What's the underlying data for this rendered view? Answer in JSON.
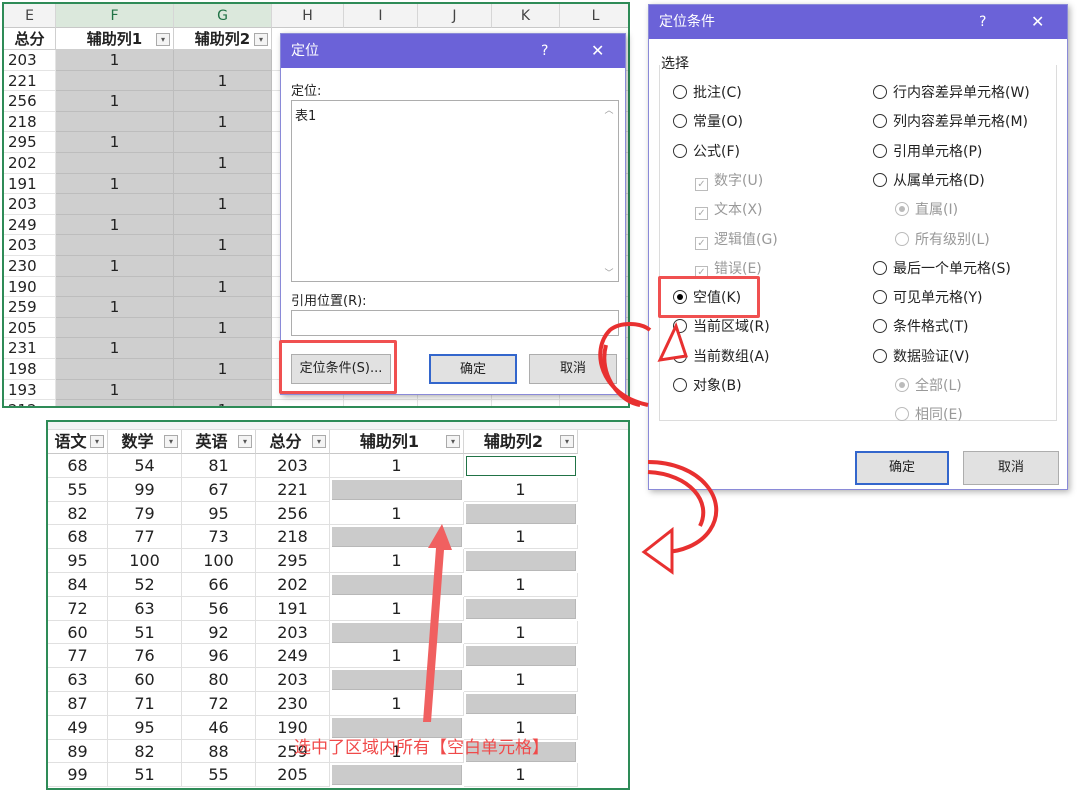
{
  "sheet1": {
    "col_letters": [
      "E",
      "F",
      "G",
      "H",
      "I",
      "J",
      "K",
      "L"
    ],
    "headers": [
      "总分",
      "辅助列1",
      "辅助列2"
    ],
    "rows": [
      [
        "203",
        "1",
        ""
      ],
      [
        "221",
        "",
        "1"
      ],
      [
        "256",
        "1",
        ""
      ],
      [
        "218",
        "",
        "1"
      ],
      [
        "295",
        "1",
        ""
      ],
      [
        "202",
        "",
        "1"
      ],
      [
        "191",
        "1",
        ""
      ],
      [
        "203",
        "",
        "1"
      ],
      [
        "249",
        "1",
        ""
      ],
      [
        "203",
        "",
        "1"
      ],
      [
        "230",
        "1",
        ""
      ],
      [
        "190",
        "",
        "1"
      ],
      [
        "259",
        "1",
        ""
      ],
      [
        "205",
        "",
        "1"
      ],
      [
        "231",
        "1",
        ""
      ],
      [
        "198",
        "",
        "1"
      ],
      [
        "193",
        "1",
        ""
      ],
      [
        "212",
        "",
        "1"
      ]
    ]
  },
  "goto_dialog": {
    "title": "定位",
    "help": "?",
    "close": "✕",
    "goto_label": "定位:",
    "list_items": [
      "表1"
    ],
    "ref_label": "引用位置(R):",
    "ref_value": "",
    "special_button": "定位条件(S)...",
    "ok_button": "确定",
    "cancel_button": "取消"
  },
  "special_dialog": {
    "title": "定位条件",
    "help": "?",
    "close": "✕",
    "group_label": "选择",
    "left_options": [
      {
        "label": "批注(C)",
        "type": "radio",
        "checked": false,
        "disabled": false
      },
      {
        "label": "常量(O)",
        "type": "radio",
        "checked": false,
        "disabled": false
      },
      {
        "label": "公式(F)",
        "type": "radio",
        "checked": false,
        "disabled": false
      },
      {
        "label": "数字(U)",
        "type": "check",
        "checked": true,
        "disabled": true
      },
      {
        "label": "文本(X)",
        "type": "check",
        "checked": true,
        "disabled": true
      },
      {
        "label": "逻辑值(G)",
        "type": "check",
        "checked": true,
        "disabled": true
      },
      {
        "label": "错误(E)",
        "type": "check",
        "checked": true,
        "disabled": true
      },
      {
        "label": "空值(K)",
        "type": "radio",
        "checked": true,
        "disabled": false
      },
      {
        "label": "当前区域(R)",
        "type": "radio",
        "checked": false,
        "disabled": false
      },
      {
        "label": "当前数组(A)",
        "type": "radio",
        "checked": false,
        "disabled": false
      },
      {
        "label": "对象(B)",
        "type": "radio",
        "checked": false,
        "disabled": false
      }
    ],
    "right_options": [
      {
        "label": "行内容差异单元格(W)",
        "type": "radio",
        "checked": false,
        "disabled": false
      },
      {
        "label": "列内容差异单元格(M)",
        "type": "radio",
        "checked": false,
        "disabled": false
      },
      {
        "label": "引用单元格(P)",
        "type": "radio",
        "checked": false,
        "disabled": false
      },
      {
        "label": "从属单元格(D)",
        "type": "radio",
        "checked": false,
        "disabled": false
      },
      {
        "label": "直属(I)",
        "type": "radio",
        "checked": true,
        "disabled": true
      },
      {
        "label": "所有级别(L)",
        "type": "radio",
        "checked": false,
        "disabled": true
      },
      {
        "label": "最后一个单元格(S)",
        "type": "radio",
        "checked": false,
        "disabled": false
      },
      {
        "label": "可见单元格(Y)",
        "type": "radio",
        "checked": false,
        "disabled": false
      },
      {
        "label": "条件格式(T)",
        "type": "radio",
        "checked": false,
        "disabled": false
      },
      {
        "label": "数据验证(V)",
        "type": "radio",
        "checked": false,
        "disabled": false
      },
      {
        "label": "全部(L)",
        "type": "radio",
        "checked": true,
        "disabled": true
      },
      {
        "label": "相同(E)",
        "type": "radio",
        "checked": false,
        "disabled": true
      }
    ],
    "ok_button": "确定",
    "cancel_button": "取消"
  },
  "sheet2": {
    "headers": [
      "语文",
      "数学",
      "英语",
      "总分",
      "辅助列1",
      "辅助列2"
    ],
    "rows": [
      [
        "68",
        "54",
        "81",
        "203",
        "1",
        ""
      ],
      [
        "55",
        "99",
        "67",
        "221",
        "",
        "1"
      ],
      [
        "82",
        "79",
        "95",
        "256",
        "1",
        ""
      ],
      [
        "68",
        "77",
        "73",
        "218",
        "",
        "1"
      ],
      [
        "95",
        "100",
        "100",
        "295",
        "1",
        ""
      ],
      [
        "84",
        "52",
        "66",
        "202",
        "",
        "1"
      ],
      [
        "72",
        "63",
        "56",
        "191",
        "1",
        ""
      ],
      [
        "60",
        "51",
        "92",
        "203",
        "",
        "1"
      ],
      [
        "77",
        "76",
        "96",
        "249",
        "1",
        ""
      ],
      [
        "63",
        "60",
        "80",
        "203",
        "",
        "1"
      ],
      [
        "87",
        "71",
        "72",
        "230",
        "1",
        ""
      ],
      [
        "49",
        "95",
        "46",
        "190",
        "",
        "1"
      ],
      [
        "89",
        "82",
        "88",
        "259",
        "1",
        ""
      ],
      [
        "99",
        "51",
        "55",
        "205",
        "",
        "1"
      ]
    ]
  },
  "annotation": "选中了区域内所有【空白单元格】",
  "colors": {
    "accent": "#6b62d8",
    "highlight": "#f05050",
    "sheet_border": "#2e8b57",
    "selected_gray": "#cfcfcf"
  }
}
